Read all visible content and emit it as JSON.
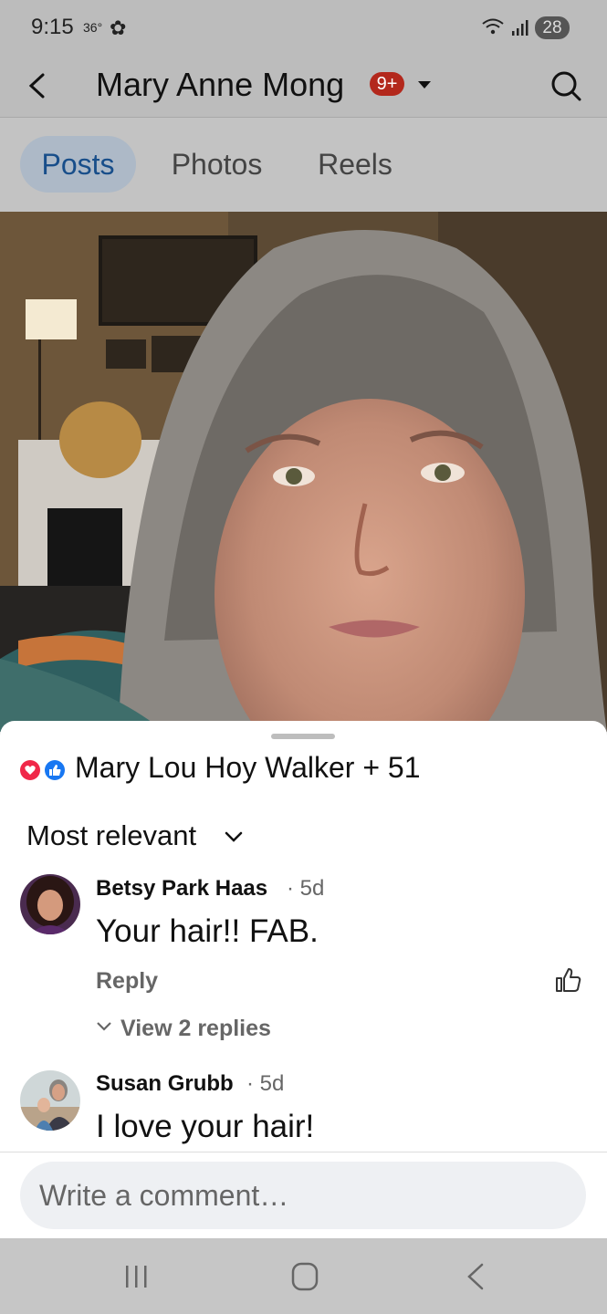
{
  "status_bar": {
    "time": "9:15",
    "temperature": "36°",
    "battery": "28"
  },
  "header": {
    "title": "Mary Anne Mong",
    "notification_badge": "9+"
  },
  "tabs": [
    {
      "label": "Posts",
      "active": true
    },
    {
      "label": "Photos",
      "active": false
    },
    {
      "label": "Reels",
      "active": false
    }
  ],
  "reactions": {
    "summary": "Mary Lou Hoy Walker + 51",
    "types": [
      "love-reaction-icon",
      "like-reaction-icon"
    ]
  },
  "sort": {
    "label": "Most relevant"
  },
  "comments": [
    {
      "author": "Betsy Park Haas",
      "time": "· 5d",
      "text": "Your hair!! FAB.",
      "reply_label": "Reply",
      "view_replies_label": "View 2 replies"
    },
    {
      "author": "Susan Grubb",
      "time": "· 5d",
      "text": "I love your hair!"
    }
  ],
  "composer": {
    "placeholder": "Write a comment…"
  },
  "colors": {
    "accent": "#184e8a",
    "badge": "#b3281c",
    "love": "#f02849",
    "like": "#1877f2"
  }
}
